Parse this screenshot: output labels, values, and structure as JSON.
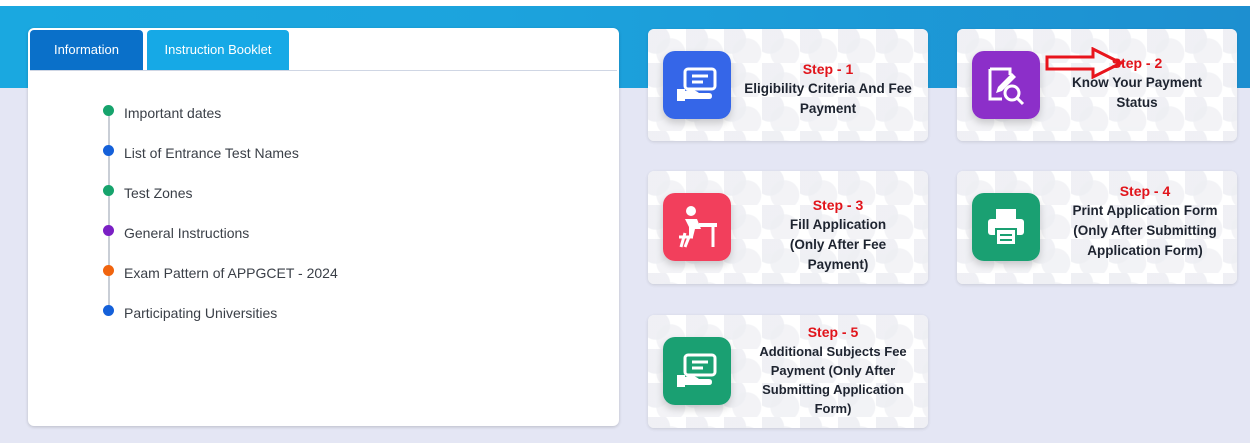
{
  "tabs": [
    {
      "label": "Information"
    },
    {
      "label": "Instruction Booklet"
    }
  ],
  "timeline": [
    {
      "label": "Important dates",
      "color": "#16a36c"
    },
    {
      "label": "List of Entrance Test Names",
      "color": "#1460d9"
    },
    {
      "label": "Test Zones",
      "color": "#16a36c"
    },
    {
      "label": "General Instructions",
      "color": "#7a1fc4"
    },
    {
      "label": "Exam Pattern of APPGCET - 2024",
      "color": "#f0640e"
    },
    {
      "label": "Participating Universities",
      "color": "#1460d9"
    }
  ],
  "steps": [
    {
      "step": "Step - 1",
      "text": "Eligibility Criteria And Fee Payment",
      "icon": "card-payment-icon",
      "icon_color": "#3566e8"
    },
    {
      "step": "Step - 2",
      "text": "Know Your Payment Status",
      "icon": "search-document-icon",
      "icon_color": "#8c2fc9"
    },
    {
      "step": "Step - 3",
      "text": "Fill Application (Only After Fee Payment)",
      "icon": "student-desk-icon",
      "icon_color": "#f23f5c"
    },
    {
      "step": "Step - 4",
      "text": "Print Application Form (Only After Submitting Application Form)",
      "icon": "printer-icon",
      "icon_color": "#1aa072"
    },
    {
      "step": "Step - 5",
      "text": "Additional Subjects Fee Payment (Only After Submitting Application Form)",
      "icon": "card-payment-icon",
      "icon_color": "#1aa072"
    }
  ],
  "colors": {
    "header_blue": "#1aa8e0",
    "tab_active": "#0a70c9",
    "tab_inactive": "#16a9e6",
    "step_red": "#e1141b",
    "arrow_red": "#e8141c"
  }
}
